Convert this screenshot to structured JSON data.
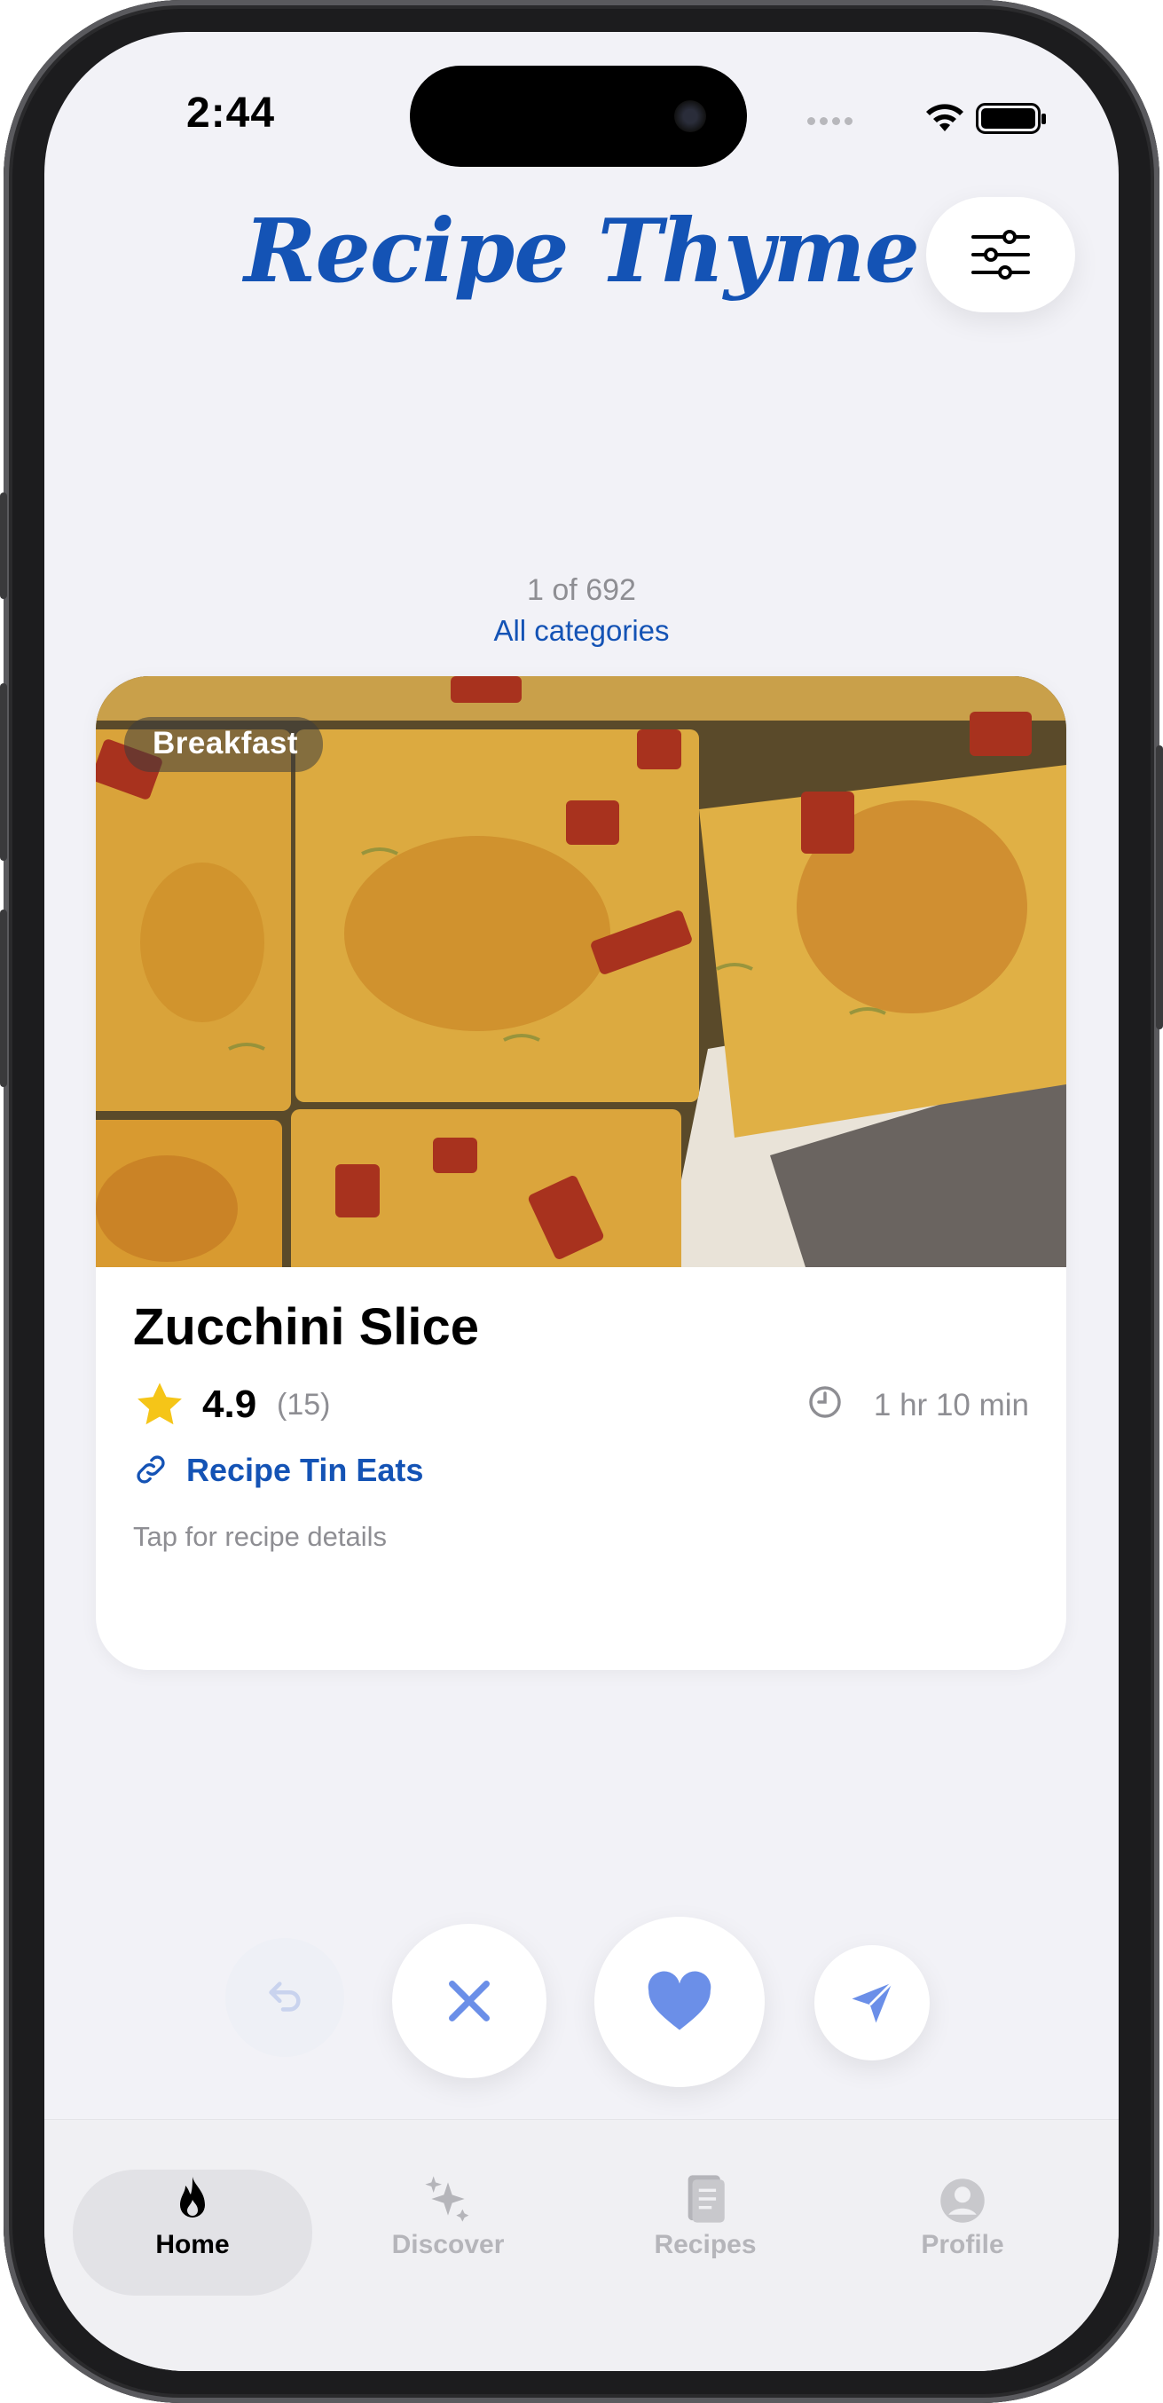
{
  "status_bar": {
    "time": "2:44"
  },
  "header": {
    "title": "Recipe Thyme",
    "filter_icon": "sliders-icon"
  },
  "deck": {
    "counter": "1 of 692",
    "category": "All categories"
  },
  "card": {
    "tag": "Breakfast",
    "name": "Zucchini Slice",
    "rating": "4.9",
    "rating_count": "(15)",
    "duration": "1 hr 10 min",
    "source": "Recipe Tin Eats",
    "hint": "Tap for recipe details"
  },
  "actions": {
    "undo_icon": "undo-arrow-icon",
    "dislike_icon": "x-icon",
    "like_icon": "heart-icon",
    "share_icon": "paper-plane-icon"
  },
  "tabs": [
    {
      "label": "Home",
      "icon": "flame-icon",
      "active": true
    },
    {
      "label": "Discover",
      "icon": "sparkles-icon",
      "active": false
    },
    {
      "label": "Recipes",
      "icon": "book-icon",
      "active": false
    },
    {
      "label": "Profile",
      "icon": "person-icon",
      "active": false
    }
  ],
  "colors": {
    "accent": "#1453b5",
    "action_blue": "#6b8fe8",
    "star": "#f5c518",
    "background": "#f2f2f7"
  }
}
